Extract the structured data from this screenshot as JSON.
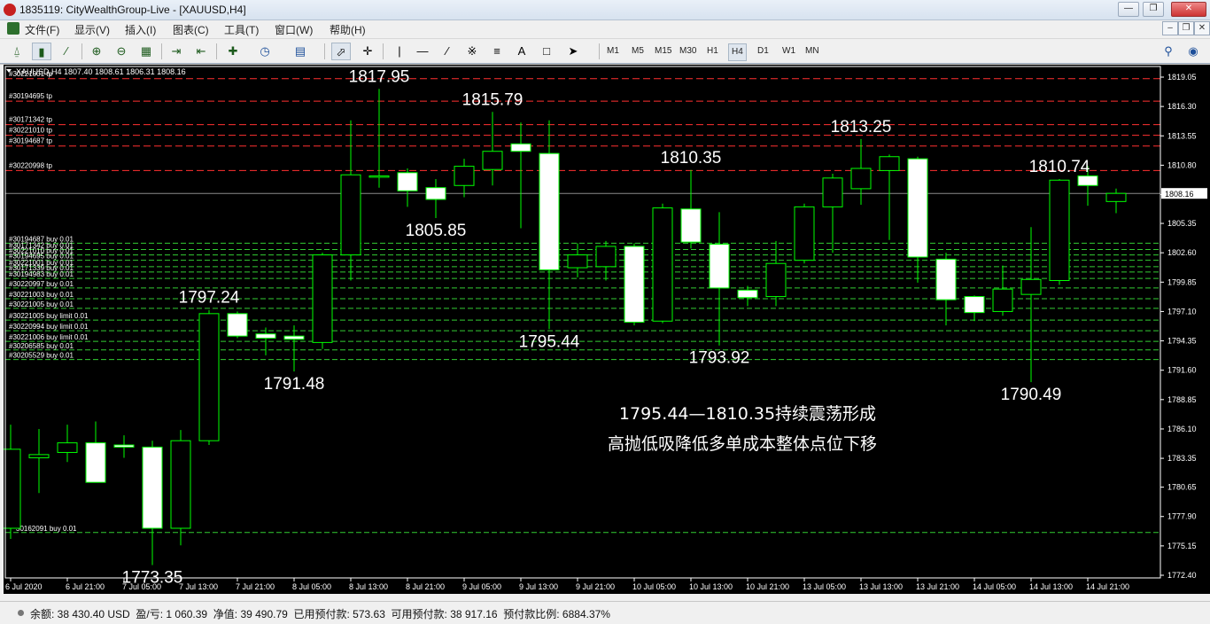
{
  "window": {
    "title": "1835119: CityWealthGroup-Live - [XAUUSD,H4]"
  },
  "menu": [
    "文件(F)",
    "显示(V)",
    "插入(I)",
    "图表(C)",
    "工具(T)",
    "窗口(W)",
    "帮助(H)"
  ],
  "timeframes": [
    "M1",
    "M5",
    "M15",
    "M30",
    "H1",
    "H4",
    "D1",
    "W1",
    "MN"
  ],
  "active_timeframe": "H4",
  "chart": {
    "symbol_line": "XAUUSD,H4  1807.40 1808.61 1806.31 1808.16",
    "current_price": "1808.16",
    "price_ticks": [
      "1819.05",
      "1816.30",
      "1813.55",
      "1810.80",
      "1808.05",
      "1805.35",
      "1802.60",
      "1799.85",
      "1797.10",
      "1794.35",
      "1791.60",
      "1788.85",
      "1786.10",
      "1783.35",
      "1780.65",
      "1777.90",
      "1775.15",
      "1772.40"
    ],
    "time_labels": [
      "6 Jul 2020",
      "6 Jul 21:00",
      "7 Jul 05:00",
      "7 Jul 13:00",
      "7 Jul 21:00",
      "8 Jul 05:00",
      "8 Jul 13:00",
      "8 Jul 21:00",
      "9 Jul 05:00",
      "9 Jul 13:00",
      "9 Jul 21:00",
      "10 Jul 05:00",
      "10 Jul 13:00",
      "10 Jul 21:00",
      "13 Jul 05:00",
      "13 Jul 13:00",
      "13 Jul 21:00",
      "14 Jul 05:00",
      "14 Jul 13:00",
      "14 Jul 21:00"
    ],
    "tp_lines": [
      {
        "label": "#30221001 tp",
        "price": 1818.9
      },
      {
        "label": "#30194695 tp",
        "price": 1816.8
      },
      {
        "label": "#30171342 tp",
        "price": 1814.6
      },
      {
        "label": "#30221010 tp",
        "price": 1813.6
      },
      {
        "label": "#30194687 tp",
        "price": 1812.6
      },
      {
        "label": "#30220998 tp",
        "price": 1810.3
      }
    ],
    "buy_lines": [
      {
        "label": "#30194687 buy 0.01",
        "price": 1803.5
      },
      {
        "label": "#30171342 buy 0.01",
        "price": 1802.9
      },
      {
        "label": "#30221010 buy 0.01",
        "price": 1802.4
      },
      {
        "label": "#30194695 buy 0.01",
        "price": 1801.9
      },
      {
        "label": "#30221001 buy 0.01",
        "price": 1801.3
      },
      {
        "label": "#30171339 buy 0.01",
        "price": 1800.8
      },
      {
        "label": "#30194983 buy 0.01",
        "price": 1800.2
      },
      {
        "label": "#30220997 buy 0.01",
        "price": 1799.3
      },
      {
        "label": "#30221003 buy 0.01",
        "price": 1798.3
      },
      {
        "label": "#30221005 buy 0.01",
        "price": 1797.4
      },
      {
        "label": "#30221005 buy limit 0.01",
        "price": 1796.3
      },
      {
        "label": "#30220994 buy limit 0.01",
        "price": 1795.3
      },
      {
        "label": "#30221006 buy limit 0.01",
        "price": 1794.3
      },
      {
        "label": "#30206585 buy 0.01",
        "price": 1793.5
      },
      {
        "label": "#30205529 buy 0.01",
        "price": 1792.6
      },
      {
        "label": "30162091 buy 0.01",
        "price": 1776.4
      }
    ],
    "annotations": [
      {
        "text": "1817.95",
        "candle": 13
      },
      {
        "text": "1815.79",
        "candle": 17
      },
      {
        "text": "1810.35",
        "candle": 24
      },
      {
        "text": "1813.25",
        "candle": 30
      },
      {
        "text": "1810.74",
        "candle": 37
      },
      {
        "text": "1805.85",
        "candle": 15
      },
      {
        "text": "1797.24",
        "candle": 7
      },
      {
        "text": "1791.48",
        "candle": 10
      },
      {
        "text": "1795.44",
        "candle": 19
      },
      {
        "text": "1793.92",
        "candle": 25
      },
      {
        "text": "1790.49",
        "candle": 36
      },
      {
        "text": "1773.35",
        "candle": 5
      }
    ],
    "note_line1": "1795.44—1810.35持续震荡形成",
    "note_line2": "高抛低吸降低多单成本整体点位下移"
  },
  "chart_data": {
    "type": "candlestick",
    "title": "XAUUSD,H4",
    "ylim": [
      1772.4,
      1819.05
    ],
    "candles": [
      {
        "o": 1776.8,
        "h": 1786.5,
        "l": 1775.8,
        "c": 1784.2
      },
      {
        "o": 1783.4,
        "h": 1786.1,
        "l": 1780.1,
        "c": 1783.7
      },
      {
        "o": 1783.9,
        "h": 1786.5,
        "l": 1783.0,
        "c": 1784.8
      },
      {
        "o": 1784.8,
        "h": 1786.8,
        "l": 1781.5,
        "c": 1781.1
      },
      {
        "o": 1784.6,
        "h": 1785.5,
        "l": 1783.4,
        "c": 1784.4
      },
      {
        "o": 1784.4,
        "h": 1785.0,
        "l": 1773.35,
        "c": 1776.8
      },
      {
        "o": 1776.8,
        "h": 1786.0,
        "l": 1775.2,
        "c": 1785.0
      },
      {
        "o": 1785.0,
        "h": 1797.24,
        "l": 1784.6,
        "c": 1796.9
      },
      {
        "o": 1796.9,
        "h": 1797.1,
        "l": 1794.6,
        "c": 1794.8
      },
      {
        "o": 1795.0,
        "h": 1795.6,
        "l": 1793.0,
        "c": 1794.6
      },
      {
        "o": 1794.8,
        "h": 1795.8,
        "l": 1791.48,
        "c": 1794.5
      },
      {
        "o": 1794.2,
        "h": 1802.6,
        "l": 1793.6,
        "c": 1802.4
      },
      {
        "o": 1802.4,
        "h": 1815.0,
        "l": 1800.0,
        "c": 1809.9
      },
      {
        "o": 1809.8,
        "h": 1817.95,
        "l": 1808.7,
        "c": 1809.8
      },
      {
        "o": 1810.1,
        "h": 1810.5,
        "l": 1806.9,
        "c": 1808.4
      },
      {
        "o": 1808.7,
        "h": 1809.5,
        "l": 1805.85,
        "c": 1807.6
      },
      {
        "o": 1808.9,
        "h": 1811.4,
        "l": 1807.8,
        "c": 1810.7
      },
      {
        "o": 1810.4,
        "h": 1815.79,
        "l": 1808.9,
        "c": 1812.1
      },
      {
        "o": 1812.8,
        "h": 1814.8,
        "l": 1804.9,
        "c": 1812.1
      },
      {
        "o": 1811.9,
        "h": 1815.0,
        "l": 1795.44,
        "c": 1801.0
      },
      {
        "o": 1801.2,
        "h": 1803.5,
        "l": 1800.3,
        "c": 1802.4
      },
      {
        "o": 1801.3,
        "h": 1803.7,
        "l": 1800.0,
        "c": 1803.2
      },
      {
        "o": 1803.2,
        "h": 1803.5,
        "l": 1795.8,
        "c": 1796.1
      },
      {
        "o": 1796.2,
        "h": 1807.2,
        "l": 1796.0,
        "c": 1806.8
      },
      {
        "o": 1806.7,
        "h": 1810.35,
        "l": 1803.0,
        "c": 1803.6
      },
      {
        "o": 1803.4,
        "h": 1806.4,
        "l": 1793.92,
        "c": 1799.3
      },
      {
        "o": 1799.1,
        "h": 1799.5,
        "l": 1797.6,
        "c": 1798.4
      },
      {
        "o": 1798.5,
        "h": 1803.7,
        "l": 1797.6,
        "c": 1801.6
      },
      {
        "o": 1801.9,
        "h": 1807.2,
        "l": 1801.6,
        "c": 1806.9
      },
      {
        "o": 1806.9,
        "h": 1810.0,
        "l": 1802.6,
        "c": 1809.6
      },
      {
        "o": 1808.6,
        "h": 1813.25,
        "l": 1807.1,
        "c": 1810.5
      },
      {
        "o": 1810.3,
        "h": 1811.8,
        "l": 1803.8,
        "c": 1811.6
      },
      {
        "o": 1811.4,
        "h": 1811.6,
        "l": 1799.8,
        "c": 1802.2
      },
      {
        "o": 1802.0,
        "h": 1802.6,
        "l": 1795.8,
        "c": 1798.2
      },
      {
        "o": 1798.5,
        "h": 1798.6,
        "l": 1796.2,
        "c": 1797.0
      },
      {
        "o": 1797.1,
        "h": 1801.4,
        "l": 1796.7,
        "c": 1799.2
      },
      {
        "o": 1798.7,
        "h": 1805.0,
        "l": 1790.49,
        "c": 1800.1
      },
      {
        "o": 1800.0,
        "h": 1809.5,
        "l": 1799.6,
        "c": 1809.4
      },
      {
        "o": 1809.8,
        "h": 1810.74,
        "l": 1807.0,
        "c": 1808.9
      },
      {
        "o": 1807.4,
        "h": 1808.61,
        "l": 1806.31,
        "c": 1808.16
      }
    ]
  },
  "status": {
    "text": "余额: 38 430.40 USD  盈/亏: 1 060.39  净值: 39 490.79  已用预付款: 573.63  可用预付款: 38 917.16  预付款比例: 6884.37%"
  },
  "colors": {
    "bull": "#00ff00",
    "body_up": "#000000",
    "body_down": "#ffffff",
    "tp_line": "#ff3030",
    "buy_line": "#33cc33",
    "grid": "#ffffff"
  }
}
